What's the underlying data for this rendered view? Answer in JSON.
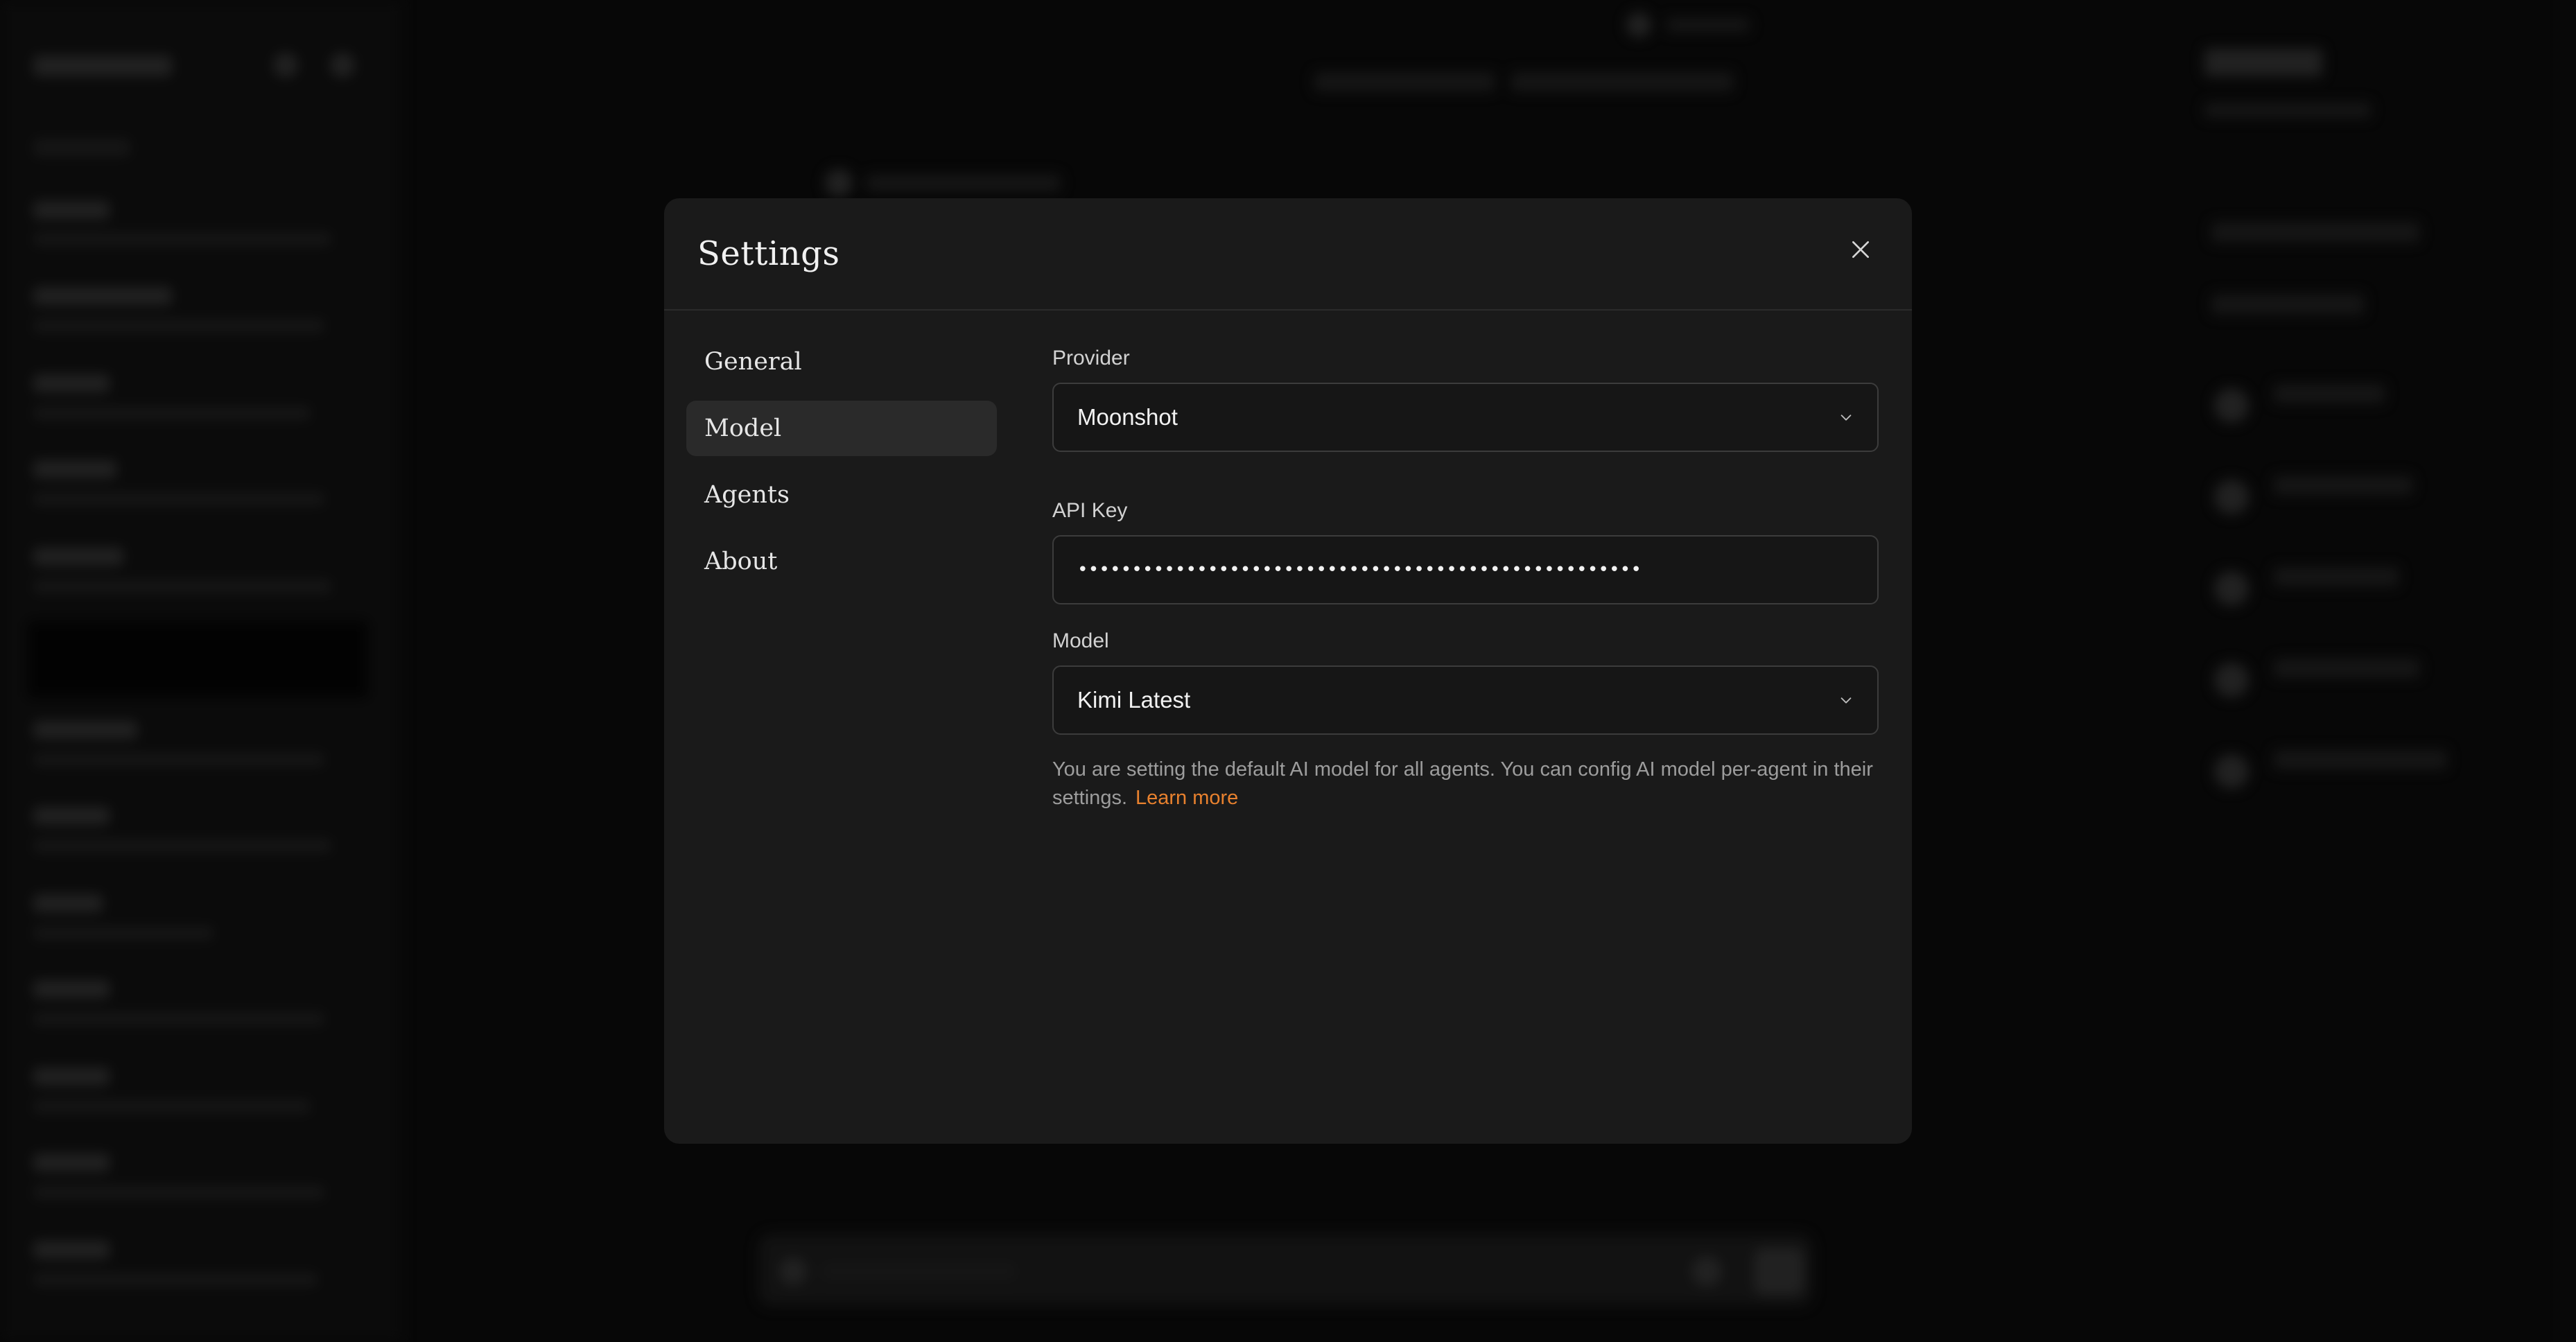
{
  "modal": {
    "title": "Settings",
    "close_label": ""
  },
  "nav": {
    "items": [
      {
        "label": "General"
      },
      {
        "label": "Model"
      },
      {
        "label": "Agents"
      },
      {
        "label": "About"
      }
    ],
    "active": "Model"
  },
  "form": {
    "provider": {
      "label": "Provider",
      "value": "Moonshot"
    },
    "api_key": {
      "label": "API Key",
      "value": "••••••••••••••••••••••••••••••••••••••••••••••••••••"
    },
    "model": {
      "label": "Model",
      "value": "Kimi Latest"
    },
    "helper_text": "You are setting the default AI model for all agents. You can config AI model per-agent in their settings.",
    "learn_more": "Learn more"
  },
  "colors": {
    "accent": "#e8812e",
    "modal_bg": "#1a1a1a",
    "active_nav_bg": "#2a2a2a"
  },
  "icons": {
    "close": "close-icon",
    "chevron": "chevron-down-icon"
  }
}
